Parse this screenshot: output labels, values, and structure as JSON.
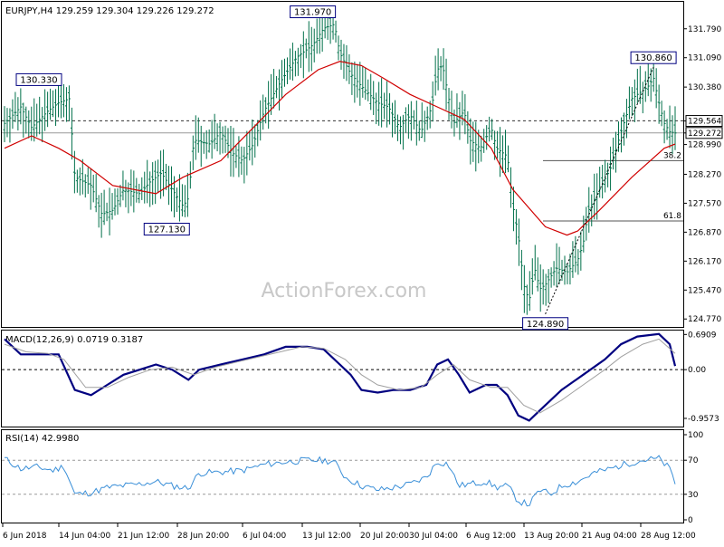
{
  "header": {
    "symbol": "EURJPY,H4",
    "ohlc": "129.259 129.304 129.226 129.272"
  },
  "watermark": "ActionForex.com",
  "colors": {
    "background": "#ffffff",
    "frame": "#000000",
    "price_bar": "#00704a",
    "ma": "#d00000",
    "macd": "#000080",
    "macd_signal": "#a0a0a0",
    "rsi": "#3a8fd8",
    "label_box": "#000080",
    "guides": "#555555"
  },
  "x_axis": {
    "labels": [
      "6 Jun 2018",
      "14 Jun 04:00",
      "21 Jun 12:00",
      "28 Jun 20:00",
      "6 Jul 04:00",
      "13 Jul 12:00",
      "20 Jul 20:00",
      "30 Jul 04:00",
      "6 Aug 12:00",
      "13 Aug 20:00",
      "21 Aug 04:00",
      "28 Aug 12:00"
    ]
  },
  "chart_data": [
    {
      "type": "candlestick",
      "panel": "price",
      "title": "EURJPY,H4",
      "y_ticks": [
        131.79,
        131.09,
        130.38,
        129.56,
        129.27,
        128.99,
        128.27,
        127.57,
        126.87,
        126.17,
        125.47,
        124.77
      ],
      "y_tick_labels": [
        "131.790",
        "131.090",
        "130.380",
        "129.564",
        "129.272",
        "128.990",
        "128.270",
        "127.570",
        "126.870",
        "126.170",
        "125.470",
        "124.770"
      ],
      "ylim": [
        124.6,
        132.42
      ],
      "approx_close_path": [
        [
          0,
          129.5
        ],
        [
          3,
          129.9
        ],
        [
          5,
          129.4
        ],
        [
          8,
          129.8
        ],
        [
          10,
          130.0
        ],
        [
          12,
          130.1
        ],
        [
          13,
          128.2
        ],
        [
          16,
          128.0
        ],
        [
          18,
          127.3
        ],
        [
          20,
          127.4
        ],
        [
          22,
          127.9
        ],
        [
          25,
          127.8
        ],
        [
          27,
          128.1
        ],
        [
          29,
          128.3
        ],
        [
          31,
          127.9
        ],
        [
          33,
          127.5
        ],
        [
          34,
          127.7
        ],
        [
          35,
          129.1
        ],
        [
          38,
          129.0
        ],
        [
          40,
          129.3
        ],
        [
          42,
          128.8
        ],
        [
          44,
          128.6
        ],
        [
          46,
          129.0
        ],
        [
          48,
          129.8
        ],
        [
          51,
          130.5
        ],
        [
          54,
          131.1
        ],
        [
          57,
          131.4
        ],
        [
          59,
          131.8
        ],
        [
          61,
          131.9
        ],
        [
          62,
          131.2
        ],
        [
          64,
          130.7
        ],
        [
          66,
          130.4
        ],
        [
          69,
          130.0
        ],
        [
          71,
          129.9
        ],
        [
          73,
          129.4
        ],
        [
          75,
          129.7
        ],
        [
          77,
          129.3
        ],
        [
          79,
          129.9
        ],
        [
          80,
          130.8
        ],
        [
          81,
          130.9
        ],
        [
          83,
          129.5
        ],
        [
          85,
          129.8
        ],
        [
          86,
          129.1
        ],
        [
          88,
          128.9
        ],
        [
          90,
          129.4
        ],
        [
          91,
          128.9
        ],
        [
          93,
          128.7
        ],
        [
          94,
          127.5
        ],
        [
          95,
          126.8
        ],
        [
          96,
          125.6
        ],
        [
          97,
          125.2
        ],
        [
          98,
          126.0
        ],
        [
          99,
          125.5
        ],
        [
          100,
          125.6
        ],
        [
          102,
          126.0
        ],
        [
          104,
          125.9
        ],
        [
          106,
          126.2
        ],
        [
          107,
          126.6
        ],
        [
          108,
          127.4
        ],
        [
          110,
          127.9
        ],
        [
          112,
          128.4
        ],
        [
          114,
          129.3
        ],
        [
          116,
          130.1
        ],
        [
          118,
          130.3
        ],
        [
          119,
          130.4
        ],
        [
          120,
          130.6
        ],
        [
          121,
          130.0
        ],
        [
          122,
          129.5
        ],
        [
          123,
          129.3
        ],
        [
          124,
          129.27
        ]
      ],
      "moving_average_path": [
        [
          0,
          128.9
        ],
        [
          5,
          129.2
        ],
        [
          10,
          128.9
        ],
        [
          14,
          128.6
        ],
        [
          20,
          128.0
        ],
        [
          28,
          127.8
        ],
        [
          33,
          128.2
        ],
        [
          40,
          128.6
        ],
        [
          46,
          129.4
        ],
        [
          52,
          130.2
        ],
        [
          58,
          130.8
        ],
        [
          62,
          131.0
        ],
        [
          66,
          130.9
        ],
        [
          70,
          130.6
        ],
        [
          75,
          130.2
        ],
        [
          80,
          129.9
        ],
        [
          85,
          129.6
        ],
        [
          90,
          128.9
        ],
        [
          94,
          127.9
        ],
        [
          100,
          127.0
        ],
        [
          104,
          126.8
        ],
        [
          106,
          126.9
        ],
        [
          110,
          127.4
        ],
        [
          116,
          128.2
        ],
        [
          122,
          128.9
        ],
        [
          124,
          129.0
        ]
      ],
      "annotations": [
        {
          "label": "130.330",
          "x": 12,
          "y": 130.33
        },
        {
          "label": "131.970",
          "x": 57,
          "y": 131.97
        },
        {
          "label": "127.130",
          "x": 30,
          "y": 127.13
        },
        {
          "label": "124.890",
          "x": 100,
          "y": 124.89
        },
        {
          "label": "130.860",
          "x": 120,
          "y": 130.86
        }
      ],
      "fib_levels": [
        {
          "label": "38.2",
          "y": 128.6
        },
        {
          "label": "61.8",
          "y": 127.14
        }
      ],
      "reference_lines": [
        129.564,
        129.272
      ]
    },
    {
      "type": "line",
      "panel": "macd",
      "title": "MACD(12,26,9) 0.0719 0.3187",
      "y_ticks": [
        0.6909,
        0.0,
        -0.9573
      ],
      "y_tick_labels": [
        "0.6909",
        "0.00",
        "-0.9573"
      ],
      "ylim": [
        -1.1,
        0.75
      ],
      "series": [
        {
          "values_path": [
            [
              0,
              0.6
            ],
            [
              3,
              0.3
            ],
            [
              6,
              0.3
            ],
            [
              10,
              0.3
            ],
            [
              13,
              -0.4
            ],
            [
              16,
              -0.5
            ],
            [
              19,
              -0.3
            ],
            [
              22,
              -0.1
            ],
            [
              25,
              0.0
            ],
            [
              28,
              0.1
            ],
            [
              31,
              0.0
            ],
            [
              34,
              -0.2
            ],
            [
              36,
              0.0
            ],
            [
              40,
              0.1
            ],
            [
              44,
              0.2
            ],
            [
              48,
              0.3
            ],
            [
              52,
              0.45
            ],
            [
              56,
              0.45
            ],
            [
              59,
              0.4
            ],
            [
              62,
              0.1
            ],
            [
              64,
              -0.1
            ],
            [
              66,
              -0.4
            ],
            [
              69,
              -0.45
            ],
            [
              72,
              -0.4
            ],
            [
              75,
              -0.4
            ],
            [
              78,
              -0.3
            ],
            [
              80,
              0.1
            ],
            [
              82,
              0.2
            ],
            [
              84,
              -0.1
            ],
            [
              86,
              -0.45
            ],
            [
              89,
              -0.3
            ],
            [
              91,
              -0.3
            ],
            [
              93,
              -0.5
            ],
            [
              95,
              -0.9
            ],
            [
              97,
              -1.0
            ],
            [
              99,
              -0.8
            ],
            [
              103,
              -0.4
            ],
            [
              107,
              -0.1
            ],
            [
              111,
              0.2
            ],
            [
              114,
              0.5
            ],
            [
              117,
              0.65
            ],
            [
              121,
              0.7
            ],
            [
              123,
              0.5
            ],
            [
              124,
              0.07
            ]
          ]
        },
        {
          "values_path": [
            [
              0,
              0.5
            ],
            [
              4,
              0.35
            ],
            [
              8,
              0.32
            ],
            [
              11,
              0.2
            ],
            [
              15,
              -0.35
            ],
            [
              19,
              -0.35
            ],
            [
              23,
              -0.15
            ],
            [
              27,
              0.0
            ],
            [
              31,
              0.05
            ],
            [
              35,
              -0.1
            ],
            [
              39,
              0.05
            ],
            [
              43,
              0.15
            ],
            [
              47,
              0.25
            ],
            [
              51,
              0.35
            ],
            [
              55,
              0.45
            ],
            [
              59,
              0.42
            ],
            [
              63,
              0.2
            ],
            [
              66,
              -0.1
            ],
            [
              69,
              -0.3
            ],
            [
              73,
              -0.4
            ],
            [
              77,
              -0.35
            ],
            [
              80,
              -0.1
            ],
            [
              83,
              0.1
            ],
            [
              86,
              -0.2
            ],
            [
              90,
              -0.35
            ],
            [
              93,
              -0.35
            ],
            [
              96,
              -0.7
            ],
            [
              99,
              -0.85
            ],
            [
              103,
              -0.6
            ],
            [
              107,
              -0.3
            ],
            [
              111,
              0.0
            ],
            [
              114,
              0.25
            ],
            [
              118,
              0.5
            ],
            [
              121,
              0.6
            ],
            [
              124,
              0.32
            ]
          ]
        }
      ]
    },
    {
      "type": "line",
      "panel": "rsi",
      "title": "RSI(14) 42.9980",
      "y_ticks": [
        100,
        70,
        30,
        0
      ],
      "y_tick_labels": [
        "100",
        "70",
        "30",
        "0"
      ],
      "ylim": [
        0,
        100
      ],
      "reference_levels": [
        70,
        30
      ],
      "values_path": [
        [
          0,
          72
        ],
        [
          3,
          60
        ],
        [
          6,
          62
        ],
        [
          9,
          58
        ],
        [
          11,
          63
        ],
        [
          13,
          30
        ],
        [
          16,
          32
        ],
        [
          19,
          38
        ],
        [
          22,
          40
        ],
        [
          25,
          42
        ],
        [
          28,
          45
        ],
        [
          31,
          40
        ],
        [
          34,
          37
        ],
        [
          36,
          55
        ],
        [
          40,
          56
        ],
        [
          44,
          58
        ],
        [
          48,
          65
        ],
        [
          52,
          68
        ],
        [
          56,
          70
        ],
        [
          59,
          70
        ],
        [
          61,
          68
        ],
        [
          63,
          50
        ],
        [
          66,
          40
        ],
        [
          69,
          35
        ],
        [
          72,
          38
        ],
        [
          75,
          42
        ],
        [
          78,
          50
        ],
        [
          80,
          68
        ],
        [
          82,
          66
        ],
        [
          84,
          40
        ],
        [
          86,
          42
        ],
        [
          89,
          45
        ],
        [
          91,
          38
        ],
        [
          93,
          40
        ],
        [
          95,
          22
        ],
        [
          97,
          18
        ],
        [
          99,
          35
        ],
        [
          101,
          30
        ],
        [
          103,
          40
        ],
        [
          106,
          45
        ],
        [
          109,
          55
        ],
        [
          112,
          60
        ],
        [
          115,
          66
        ],
        [
          118,
          70
        ],
        [
          121,
          72
        ],
        [
          123,
          60
        ],
        [
          124,
          43
        ]
      ]
    }
  ]
}
